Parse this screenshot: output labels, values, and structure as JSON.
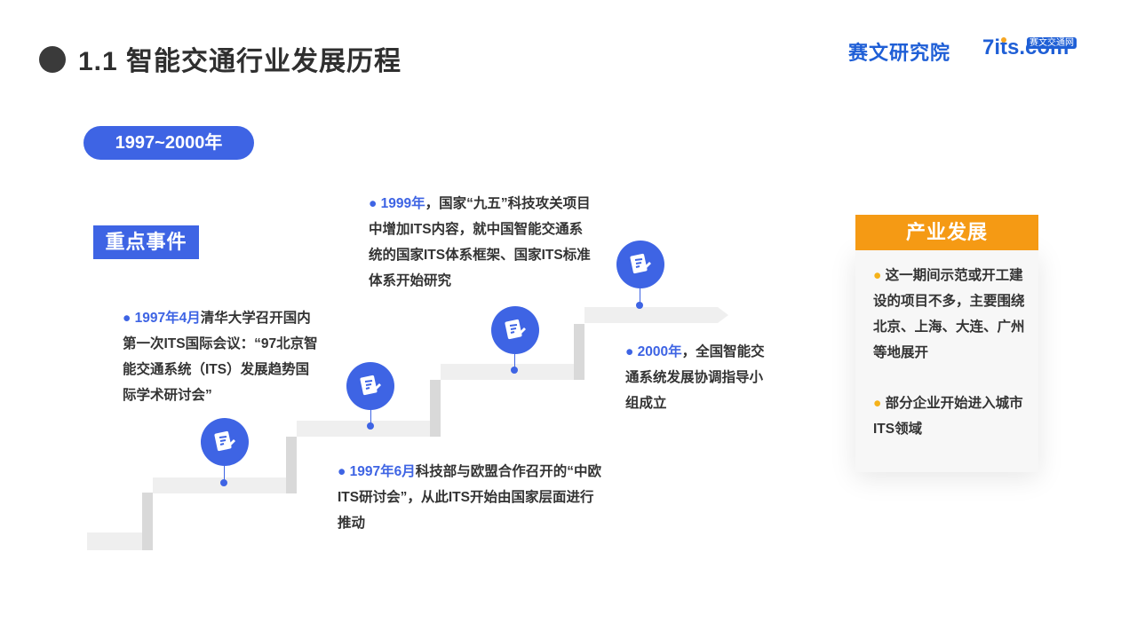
{
  "header": {
    "title": "1.1 智能交通行业发展历程",
    "logo_left": "赛文研究院",
    "logo_right_prefix": "7",
    "logo_right_suffix": "its.com",
    "logo_right_tag": "赛文交通网"
  },
  "period_label": "1997~2000年",
  "key_events_label": "重点事件",
  "events": [
    {
      "date": "1997年4月",
      "text": "清华大学召开国内第一次ITS国际会议：“97北京智能交通系统（ITS）发展趋势国际学术研讨会”"
    },
    {
      "date": "1997年6月",
      "text": "科技部与欧盟合作召开的“中欧ITS研讨会”，从此ITS开始由国家层面进行推动"
    },
    {
      "date": "1999年",
      "text": "，国家“九五”科技攻关项目中增加ITS内容，就中国智能交通系统的国家ITS体系框架、国家ITS标准体系开始研究"
    },
    {
      "date": "2000年",
      "text": "，全国智能交通系统发展协调指导小组成立"
    }
  ],
  "industry": {
    "title": "产业发展",
    "items": [
      "这一期间示范或开工建设的项目不多，主要围绕北京、上海、大连、广州等地展开",
      "部分企业开始进入城市ITS领域"
    ]
  },
  "colors": {
    "accent": "#3e64e4",
    "orange": "#f59a14",
    "stair": "#ececec"
  },
  "icons": {
    "marker": "note-pen-icon",
    "title_bullet": "circle-bullet"
  }
}
